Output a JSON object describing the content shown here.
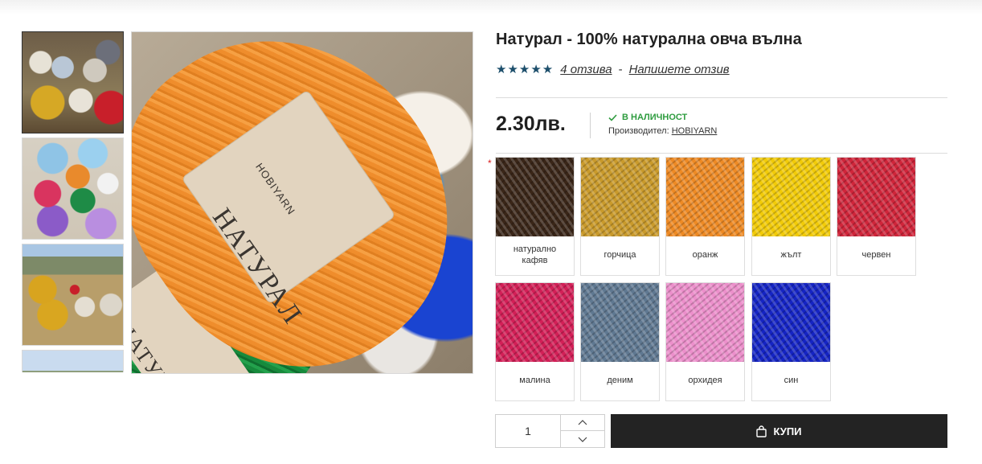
{
  "product": {
    "title": "Натурал - 100% натурална овча вълна",
    "rating_stars": "★★★★★",
    "rating_value": 5,
    "reviews_link": "4 отзива",
    "separator": "-",
    "write_review_link": "Напишете отзив",
    "price": "2.30лв.",
    "stock_status": "В НАЛИЧНОСТ",
    "manufacturer_label": "Производител:",
    "manufacturer_name": "HOBIYARN",
    "required_mark": "*"
  },
  "gallery": {
    "thumbnails": [
      "yarn-outdoor-pile",
      "colorful-skeins",
      "skeins-on-hillside",
      "mountain-landscape"
    ],
    "main_image_label": "НАТУРАЛ",
    "main_image_brand": "HOBIYARN"
  },
  "colors": [
    {
      "label": "натурално кафяв",
      "hex": "#3a2618"
    },
    {
      "label": "горчица",
      "hex": "#c99a2b"
    },
    {
      "label": "оранж",
      "hex": "#ee8a24"
    },
    {
      "label": "жълт",
      "hex": "#f2cb08"
    },
    {
      "label": "червен",
      "hex": "#d0253a"
    },
    {
      "label": "малина",
      "hex": "#d31f57"
    },
    {
      "label": "деним",
      "hex": "#5f7891"
    },
    {
      "label": "орхидея",
      "hex": "#ec8fcb"
    },
    {
      "label": "син",
      "hex": "#1524c4"
    }
  ],
  "cart": {
    "quantity": "1",
    "buy_label": "КУПИ"
  }
}
